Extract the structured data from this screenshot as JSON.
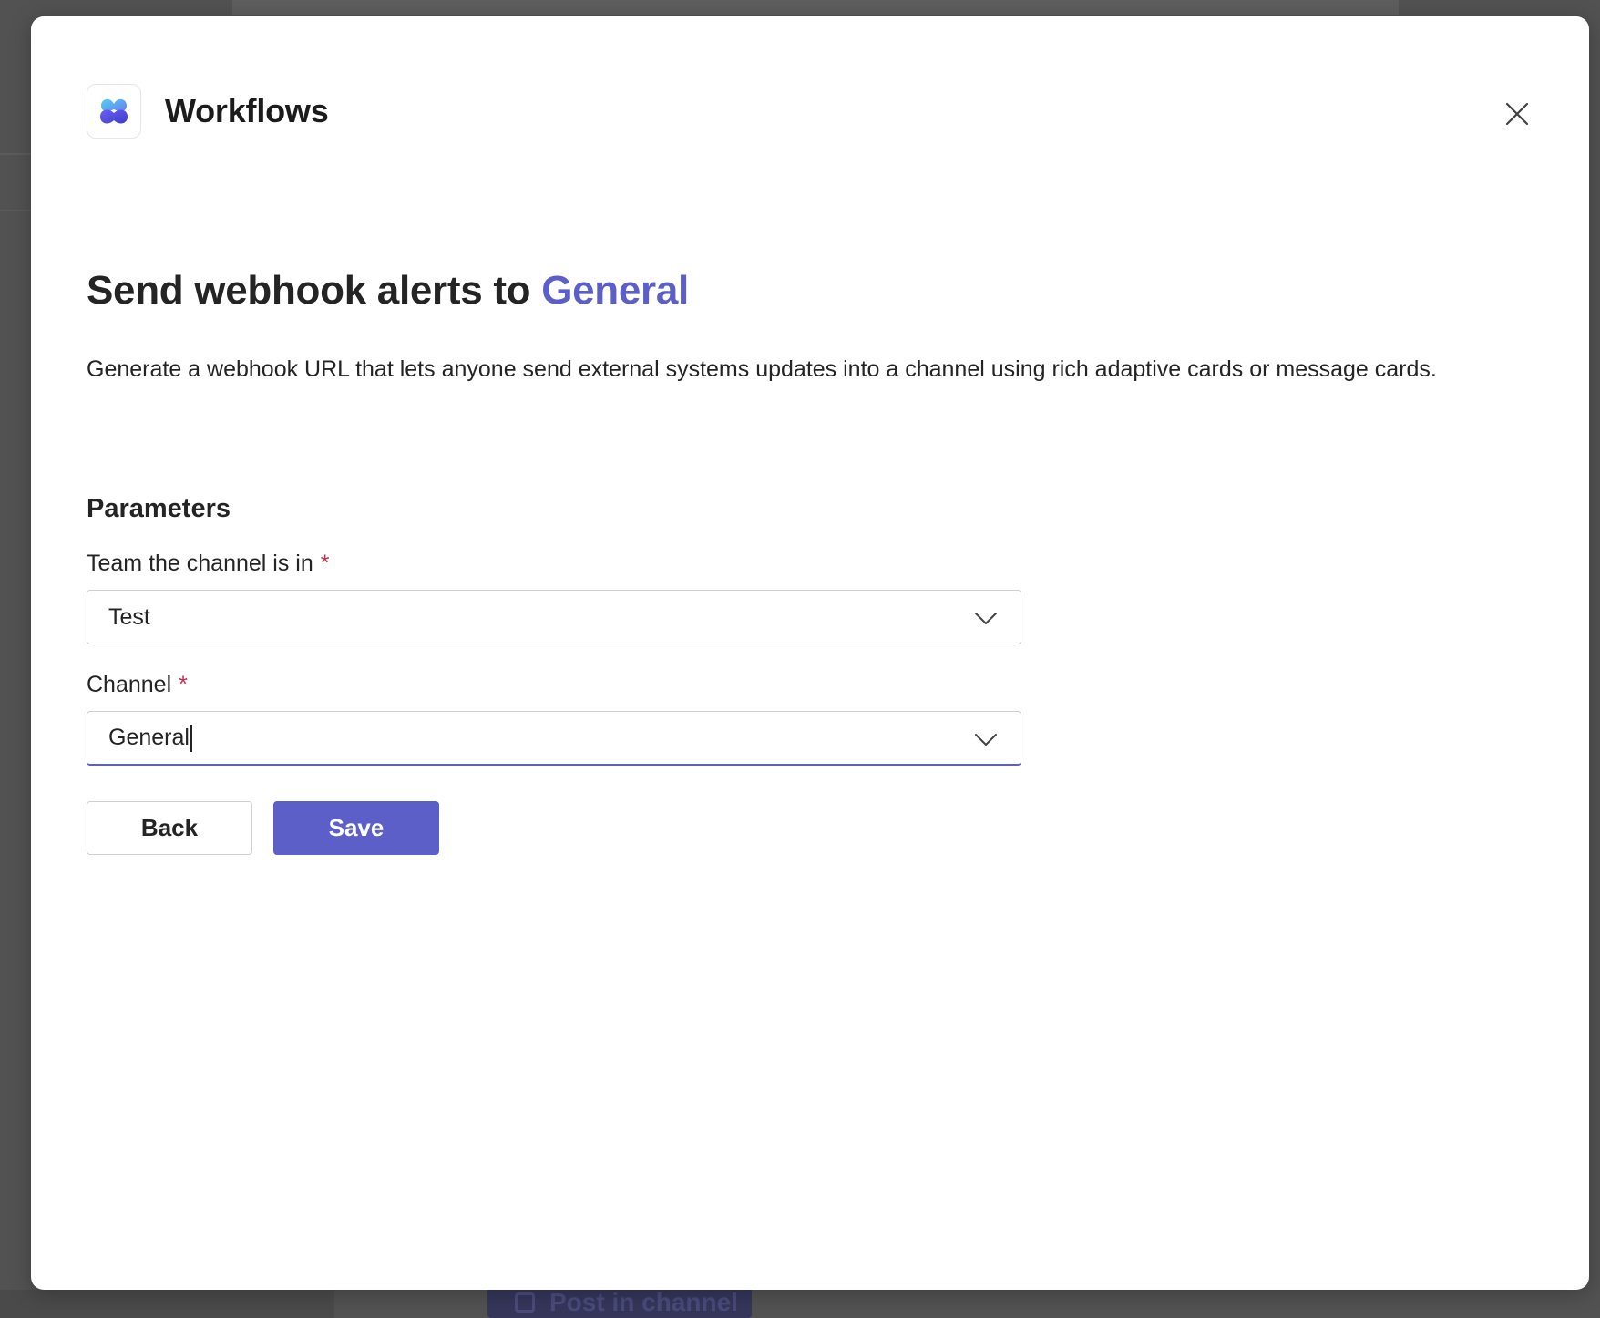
{
  "background": {
    "post_button_label": "Post in channel"
  },
  "modal": {
    "app_name": "Workflows",
    "app_icon": "workflows-logo-icon",
    "close_icon": "close-icon",
    "title_prefix": "Send webhook alerts to",
    "title_accent": "General",
    "description": "Generate a webhook URL that lets anyone send external systems updates into a channel using rich adaptive cards or message cards.",
    "section_heading": "Parameters",
    "fields": {
      "team": {
        "label": "Team the channel is in",
        "required_marker": "*",
        "value": "Test"
      },
      "channel": {
        "label": "Channel",
        "required_marker": "*",
        "value": "General"
      }
    },
    "buttons": {
      "back_label": "Back",
      "save_label": "Save"
    }
  },
  "colors": {
    "accent": "#5b5fc7",
    "required": "#c4314b",
    "overlay": "#525252"
  }
}
